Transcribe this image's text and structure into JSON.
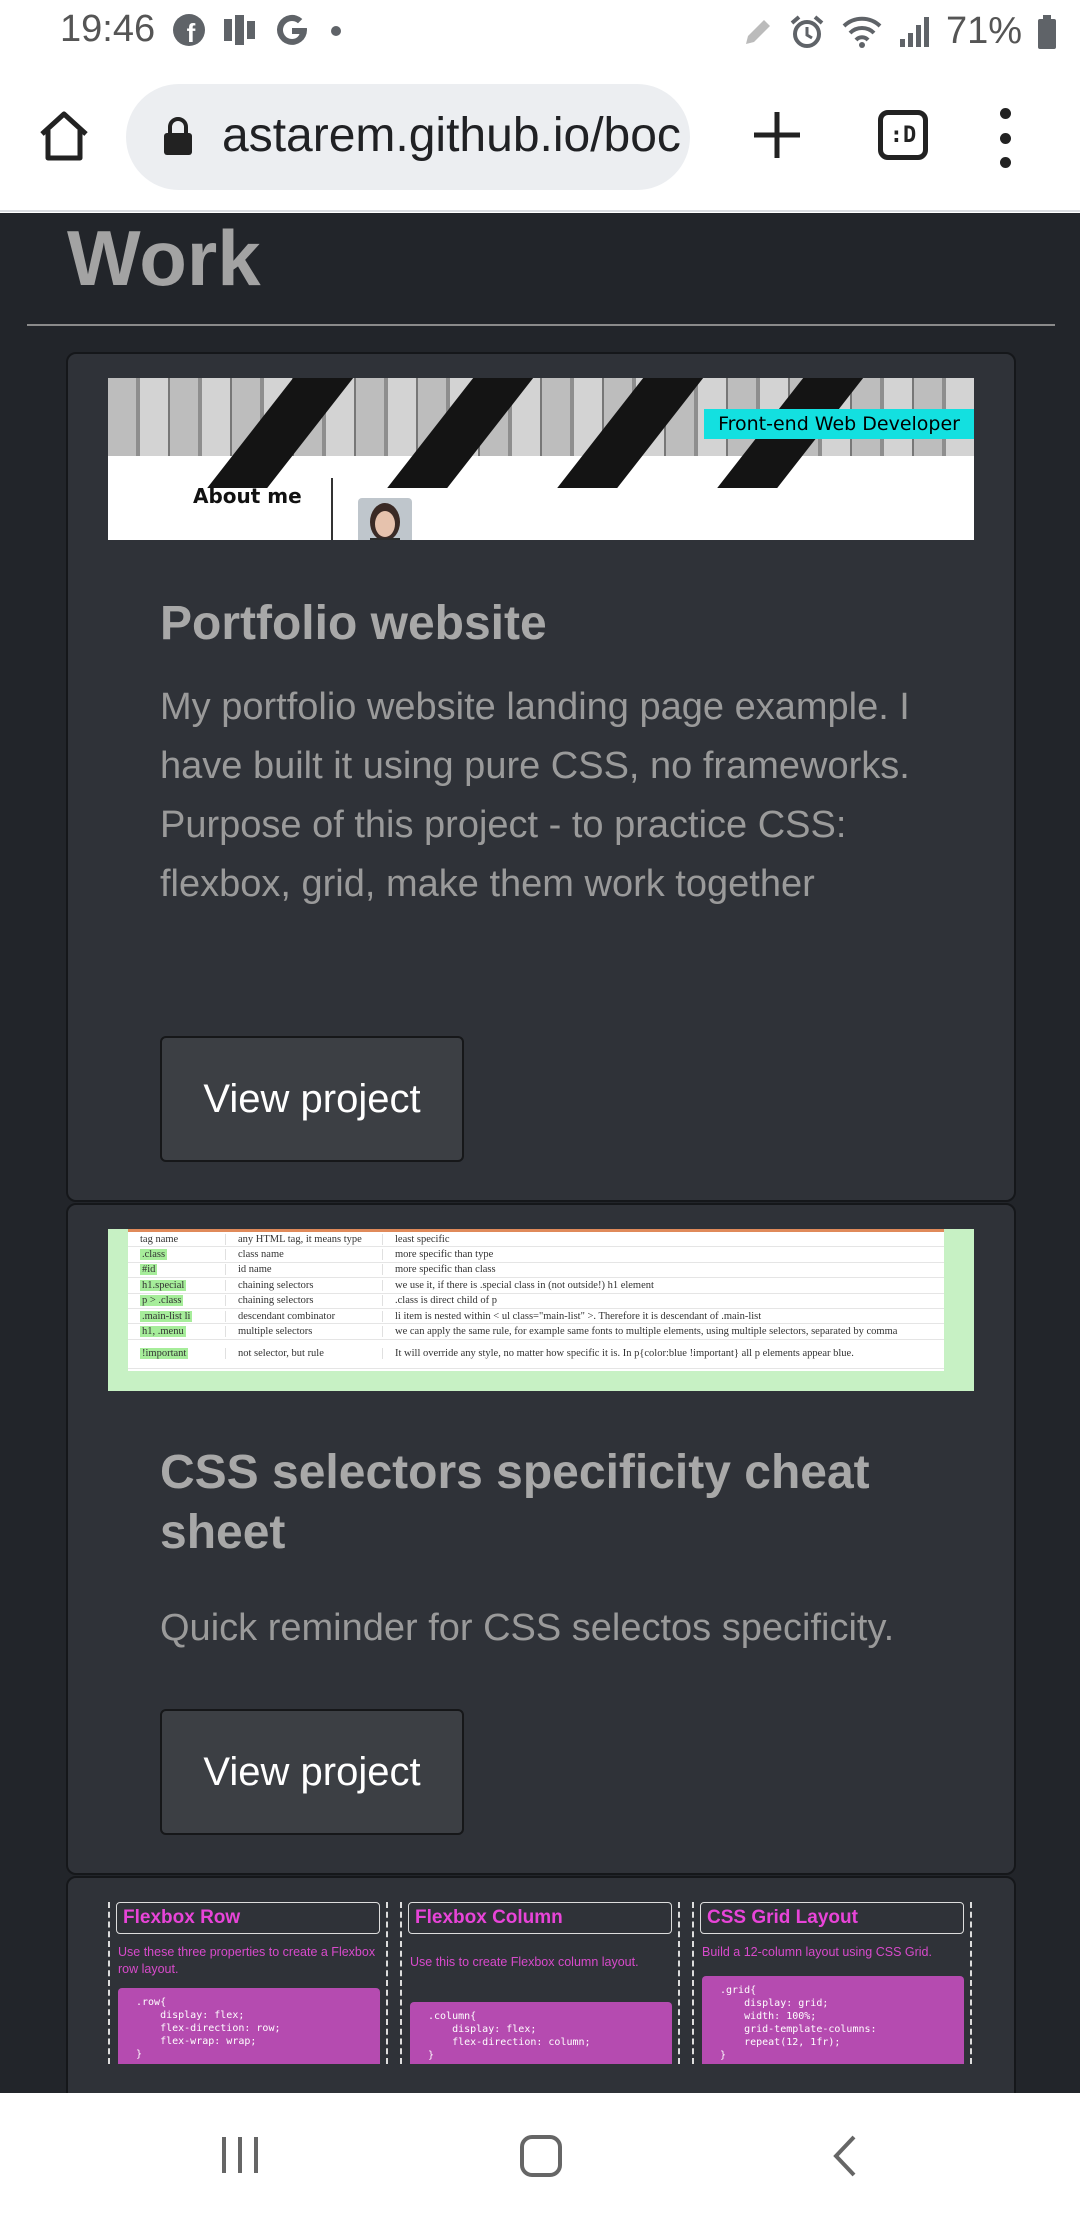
{
  "status_bar": {
    "time": "19:46",
    "battery": "71%"
  },
  "browser": {
    "url": "astarem.github.io/boc",
    "tabs_label": ":D"
  },
  "section": {
    "title": "Work"
  },
  "cards": [
    {
      "title": "Portfolio website",
      "description": "My portfolio website landing page example. I have built it using pure CSS, no frameworks. Purpose of this project - to practice CSS: flexbox, grid, make them work together",
      "button": "View project",
      "preview": {
        "badge": "Front-end Web Developer",
        "nav_label": "About me"
      }
    },
    {
      "title": "CSS selectors specificity cheat sheet",
      "description": "Quick reminder for CSS selectos specificity.",
      "button": "View project",
      "preview": {
        "rows": [
          {
            "sel": "tag name",
            "type": "any HTML tag, it means type",
            "desc": "least specific"
          },
          {
            "sel": ".class",
            "type": "class name",
            "desc": "more specific than type"
          },
          {
            "sel": "#id",
            "type": "id name",
            "desc": "more specific than class"
          },
          {
            "sel": "h1.special",
            "type": "chaining selectors",
            "desc": "we use it, if there is .special class in (not outside!) h1 element"
          },
          {
            "sel": "p > .class",
            "type": "chaining selectors",
            "desc": ".class is direct child of p"
          },
          {
            "sel": ".main-list li",
            "type": "descendant combinator",
            "desc": "li item is nested within < ul class=\"main-list\" >. Therefore it is descendant of .main-list"
          },
          {
            "sel": "h1, .menu",
            "type": "multiple selectors",
            "desc": "we can apply the same rule, for example same fonts to multiple elements, using multiple selectors, separated by comma"
          },
          {
            "sel": "!important",
            "type": "not selector, but rule",
            "desc": "It will override any style, no matter how specific it is. In p{color:blue !important} all p elements appear blue."
          }
        ]
      }
    },
    {
      "preview": {
        "columns": [
          {
            "title": "Flexbox Row",
            "text": "Use these three properties to create a Flexbox row layout.",
            "code": ".row{\n    display: flex;\n    flex-direction: row;\n    flex-wrap: wrap;\n}"
          },
          {
            "title": "Flexbox Column",
            "text": "Use this to create Flexbox column layout.",
            "code": ".column{\n    display: flex;\n    flex-direction: column;\n}"
          },
          {
            "title": "CSS Grid Layout",
            "text": "Build a 12-column layout using CSS Grid.",
            "code": ".grid{\n    display: grid;\n    width: 100%;\n    grid-template-columns:\n    repeat(12, 1fr);\n}"
          }
        ]
      }
    }
  ],
  "icons": {
    "status_left": [
      "facebook-icon",
      "app-icon",
      "google-icon",
      "dot-icon"
    ],
    "status_right": [
      "pen-icon",
      "alarm-icon",
      "wifi-icon",
      "signal-icon",
      "battery-icon"
    ],
    "nav": [
      "recents-icon",
      "home-icon",
      "back-icon"
    ]
  }
}
